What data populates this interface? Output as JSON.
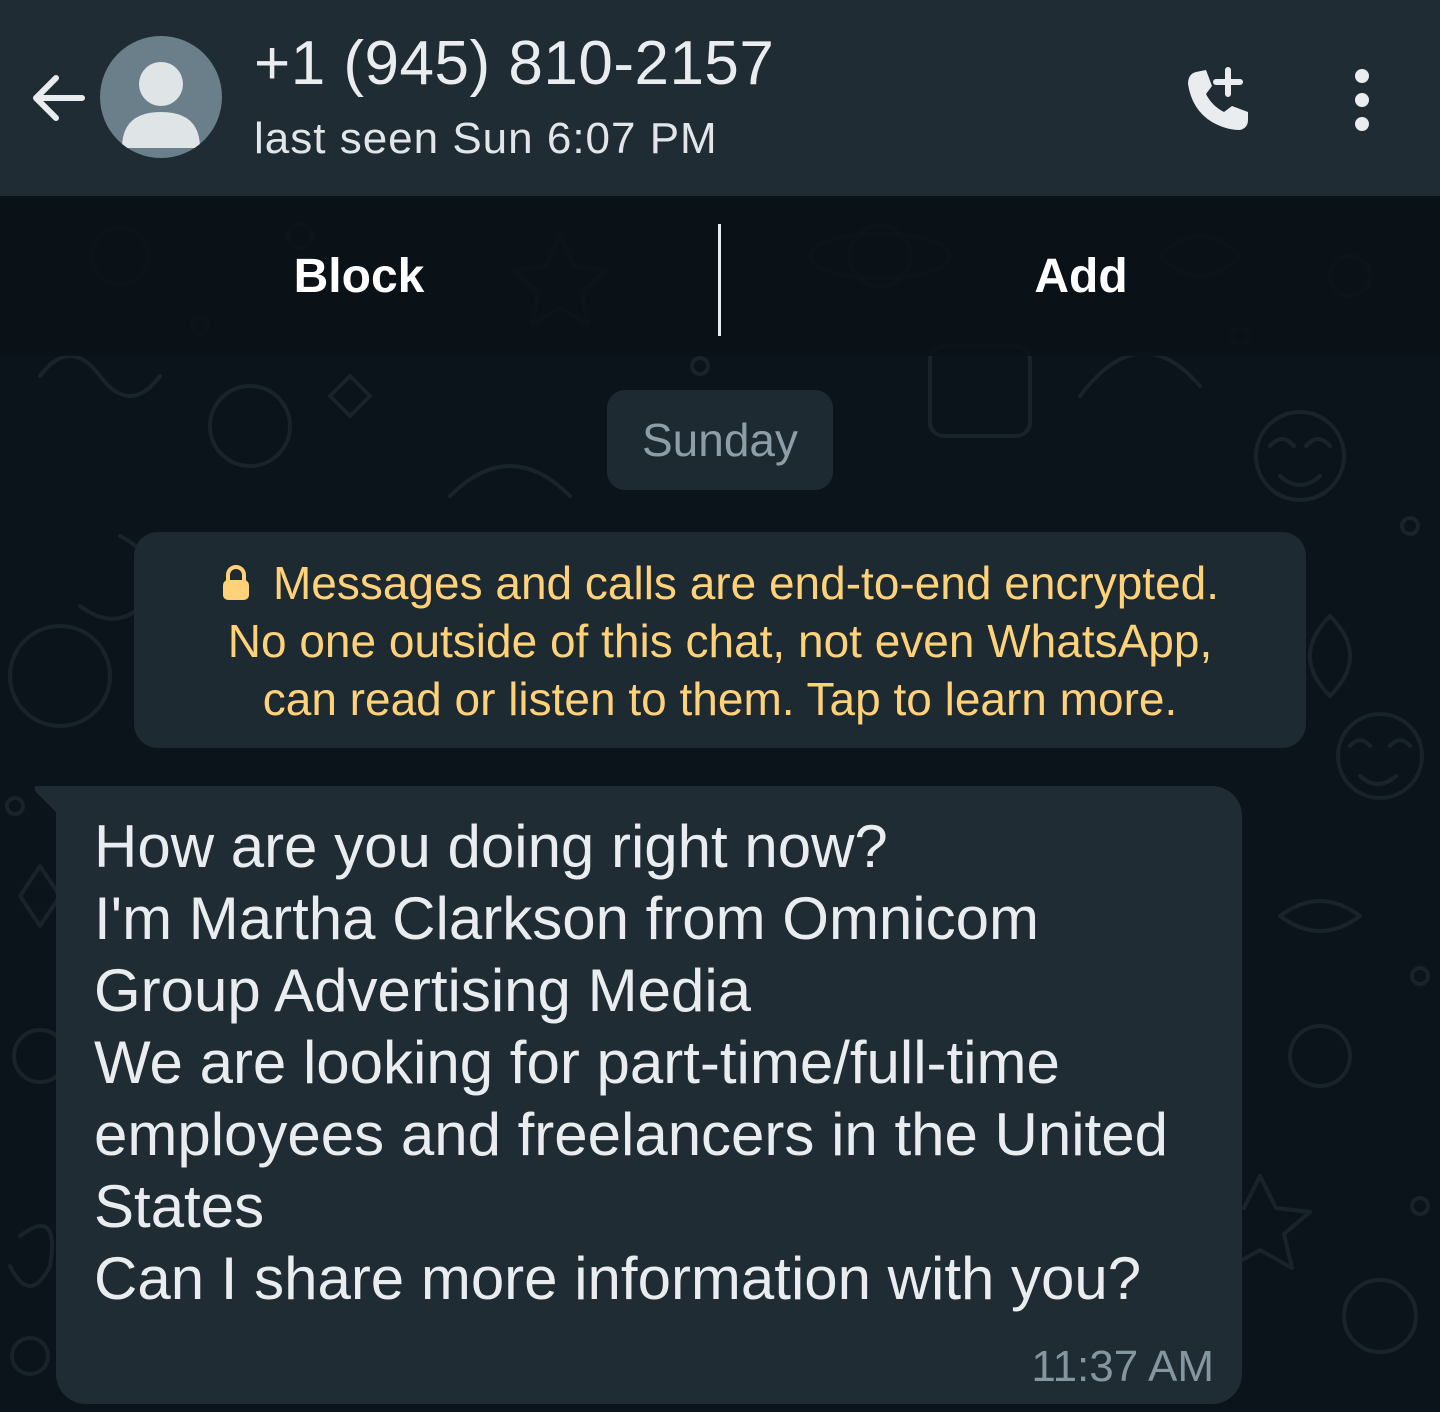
{
  "header": {
    "back_icon": "arrow-left-icon",
    "avatar_icon": "default-person-icon",
    "contact_name": "+1 (945) 810-2157",
    "status": "last seen Sun 6:07 PM",
    "call_icon": "phone-add-icon",
    "menu_icon": "more-vert-icon"
  },
  "actions": {
    "block_label": "Block",
    "add_label": "Add"
  },
  "chat": {
    "date_label": "Sunday",
    "notice": {
      "lock_icon": "lock-icon",
      "color": "#ffd279",
      "lines": [
        "Messages and calls are end-to-end encrypted.",
        "No one outside of this chat, not even WhatsApp,",
        "can read or listen to them. Tap to learn more."
      ]
    },
    "messages": [
      {
        "lines": [
          "How are you doing right now?",
          "I'm Martha Clarkson from Omnicom",
          "Group Advertising Media",
          "We are looking for part-time/full-time",
          "employees and freelancers in the United",
          "States",
          "Can I share more information with you?"
        ],
        "time": "11:37 AM"
      }
    ]
  },
  "colors": {
    "header_bg": "#1f2c33",
    "chat_bg": "#0b141a",
    "bubble_bg": "#1f2c33",
    "text_primary": "#e9edef",
    "text_secondary": "#8696a0"
  }
}
